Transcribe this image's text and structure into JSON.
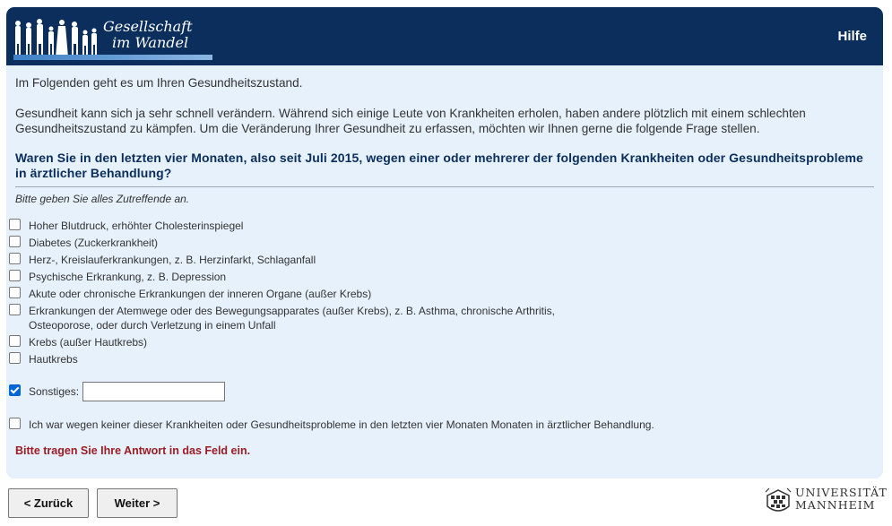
{
  "header": {
    "logo_line1": "Gesellschaft",
    "logo_line2": "im Wandel",
    "help_label": "Hilfe",
    "bg_color": "#0b2e5c"
  },
  "intro": {
    "p1": "Im Folgenden geht es um Ihren Gesundheitszustand.",
    "p2": "Gesundheit kann sich ja sehr schnell verändern. Während sich einige Leute von Krankheiten erholen, haben andere plötzlich mit einem schlechten Gesundheitszustand zu kämpfen. Um die Veränderung Ihrer Gesundheit zu erfassen, möchten wir Ihnen gerne die folgende Frage stellen."
  },
  "question": {
    "text": "Waren Sie in den letzten vier Monaten, also seit Juli 2015, wegen einer oder mehrerer der folgenden Krankheiten oder Gesundheitsprobleme in ärztlicher Behandlung?",
    "instruction": "Bitte geben Sie alles Zutreffende an."
  },
  "options": [
    {
      "label": "Hoher Blutdruck, erhöhter Cholesterinspiegel",
      "checked": false
    },
    {
      "label": "Diabetes (Zuckerkrankheit)",
      "checked": false
    },
    {
      "label": "Herz-, Kreislauferkrankungen, z. B. Herzinfarkt, Schlaganfall",
      "checked": false
    },
    {
      "label": "Psychische Erkrankung, z. B. Depression",
      "checked": false
    },
    {
      "label": "Akute oder chronische Erkrankungen der inneren Organe (außer Krebs)",
      "checked": false
    },
    {
      "label": "Erkrankungen der Atemwege oder des Bewegungsapparates (außer Krebs), z. B. Asthma, chronische Arthritis, Osteoporose, oder durch Verletzung in einem Unfall",
      "checked": false
    },
    {
      "label": "Krebs (außer Hautkrebs)",
      "checked": false
    },
    {
      "label": "Hautkrebs",
      "checked": false
    }
  ],
  "other": {
    "label": "Sonstiges:",
    "checked": true,
    "value": ""
  },
  "none_option": {
    "label": "Ich war wegen keiner dieser Krankheiten oder Gesundheitsprobleme in den letzten vier Monaten Monaten in ärztlicher Behandlung.",
    "checked": false
  },
  "error_message": "Bitte tragen Sie Ihre Antwort in das Feld ein.",
  "nav": {
    "back_label": "< Zurück",
    "next_label": "Weiter >"
  },
  "footer": {
    "university_line1": "UNIVERSITÄT",
    "university_line2": "MANNHEIM"
  }
}
